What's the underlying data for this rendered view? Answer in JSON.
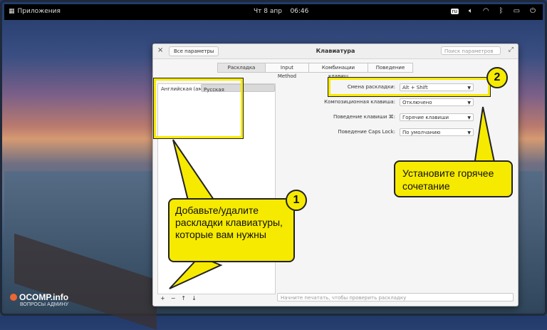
{
  "topbar": {
    "apps_label": "Приложения",
    "clock_day": "Чт 8 апр",
    "clock_time": "06:46",
    "lang": "ru"
  },
  "window": {
    "close_glyph": "×",
    "back_label": "Все параметры",
    "title": "Клавиатура",
    "search_placeholder": "Поиск параметров",
    "tabs": [
      "Раскладка",
      "Input Method",
      "Комбинации клавиш",
      "Поведение"
    ],
    "layouts": [
      "Русская",
      "Английская (американская)"
    ],
    "form": [
      {
        "label": "Смена раскладки:",
        "value": "Alt + Shift"
      },
      {
        "label": "Композиционная клавиша:",
        "value": "Отключено"
      },
      {
        "label": "Поведение клавиши ⌘:",
        "value": "Горячие клавиши"
      },
      {
        "label": "Поведение Caps Lock:",
        "value": "По умолчанию"
      }
    ],
    "toolbar": {
      "add": "+",
      "remove": "−",
      "up": "↑",
      "down": "↓"
    },
    "test_placeholder": "Начните печатать, чтобы проверить раскладку"
  },
  "callouts": {
    "one": {
      "num": "1",
      "text": "Добавьте/удалите раскладки клавиатуры, которые вам нужны"
    },
    "two": {
      "num": "2",
      "text": "Установите горячее сочетание"
    }
  },
  "watermark": {
    "title": "OCOMP.info",
    "subtitle": "ВОПРОСЫ АДМИНУ"
  },
  "colors": {
    "callout": "#f6ea00"
  }
}
